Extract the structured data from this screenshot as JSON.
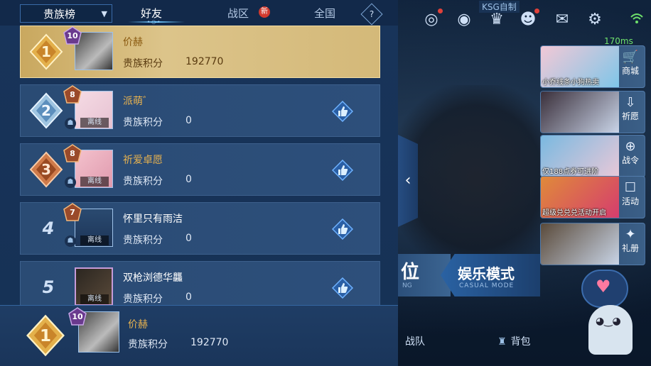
{
  "tabs": {
    "dropdown_value": "贵族榜",
    "friends": "好友",
    "region": "战区",
    "region_badge": "新",
    "national": "全国",
    "help": "?"
  },
  "ranking": [
    {
      "rank": "1",
      "level": "10",
      "name": "价赫",
      "label": "贵族积分",
      "score": "192770",
      "status": "",
      "is_me": true
    },
    {
      "rank": "2",
      "level": "8",
      "name": "派萌゛",
      "label": "贵族积分",
      "score": "0",
      "status": "离线",
      "is_me": false
    },
    {
      "rank": "3",
      "level": "8",
      "name": "祈爱卓愿",
      "label": "贵族积分",
      "score": "0",
      "status": "离线",
      "is_me": false
    },
    {
      "rank": "4",
      "level": "7",
      "name": "怀里只有雨洁",
      "label": "贵族积分",
      "score": "0",
      "status": "离线",
      "is_me": false
    },
    {
      "rank": "5",
      "level": "",
      "name": "双枪浏德华龘",
      "label": "贵族积分",
      "score": "0",
      "status": "离线",
      "is_me": false
    }
  ],
  "footer": {
    "rank": "1",
    "level": "10",
    "name": "价赫",
    "label": "贵族积分",
    "score": "192770"
  },
  "right": {
    "ksg": "KSG自制",
    "ping": "170ms",
    "cards": [
      {
        "caption": "小乔线条小狗热卖",
        "tag": "商城"
      },
      {
        "caption": "",
        "tag": "祈愿"
      },
      {
        "caption": "仅188点券可进阶",
        "tag": "战令"
      },
      {
        "caption": "超级兑兑兑活动开启",
        "tag": "活动"
      },
      {
        "caption": "",
        "tag": "礼册"
      }
    ],
    "mode_rank": "位",
    "mode_rank_sub": "NG",
    "mode_casual": "娱乐模式",
    "mode_casual_sub": "CASUAL MODE",
    "team": "战队",
    "bag": "背包"
  },
  "colors": {
    "gold": "#e8b24f",
    "panel": "#18345a",
    "like": "#3e86d6"
  }
}
